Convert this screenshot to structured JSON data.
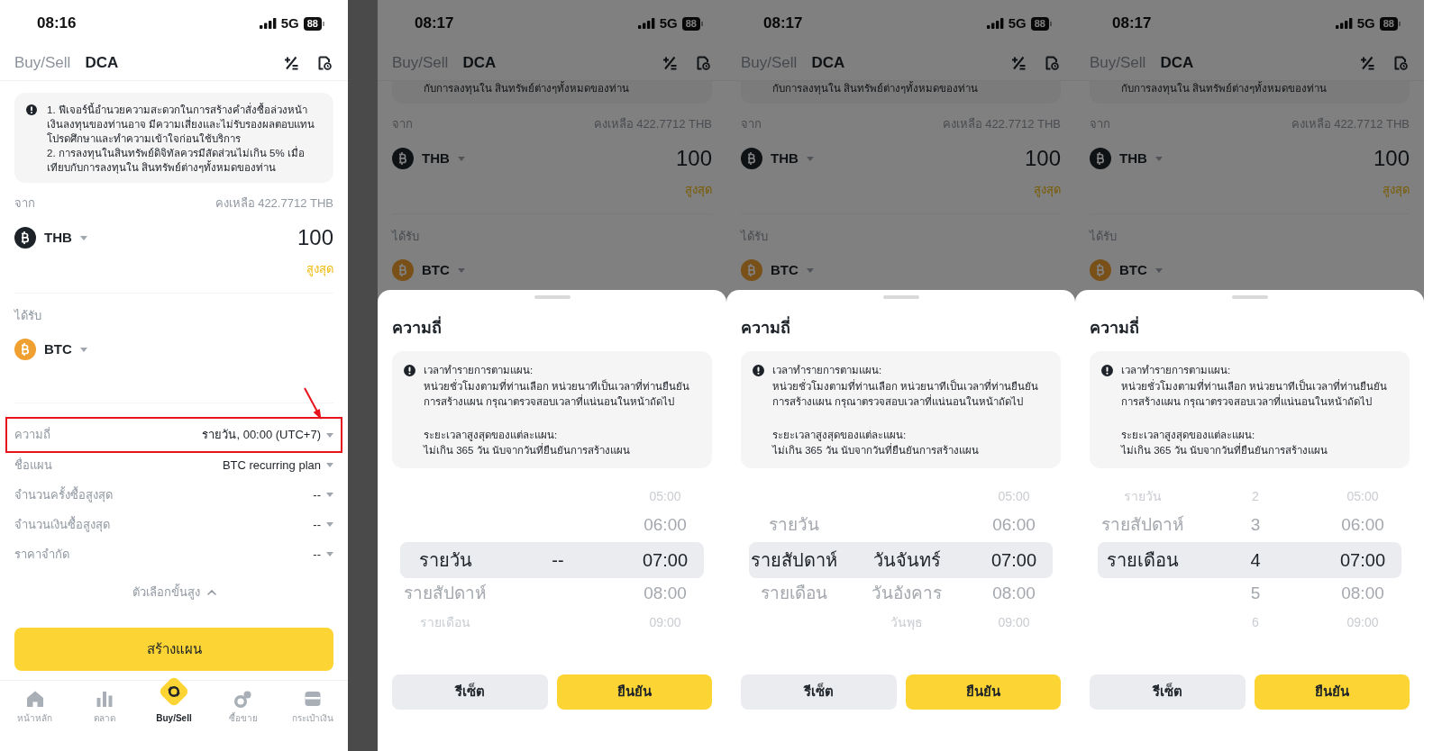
{
  "screens": [
    {
      "status_bar": {
        "time": "08:16",
        "network": "5G",
        "battery": "88"
      },
      "tabs": [
        {
          "label": "Buy/Sell",
          "selected": false
        },
        {
          "label": "DCA",
          "selected": true
        }
      ],
      "notice": {
        "clipped": false,
        "paragraphs": [
          "1. ฟีเจอร์นี้อำนวยความสะดวกในการสร้างคำสั่งซื้อล่วงหน้า เงินลงทุนของท่านอาจ มีความเสี่ยงและไม่รับรองผลตอบแทน โปรดศึกษาและทำความเข้าใจก่อนใช้บริการ",
          "2. การลงทุนในสินทรัพย์ดิจิทัลควรมีสัดส่วนไม่เกิน 5% เมื่อเทียบกับการลงทุนใน สินทรัพย์ต่างๆทั้งหมดของท่าน"
        ]
      },
      "from": {
        "label": "จาก",
        "balance": "คงเหลือ 422.7712 THB",
        "currency": "THB",
        "amount": "100",
        "max_label": "สูงสุด"
      },
      "to": {
        "label": "ได้รับ",
        "currency": "BTC"
      },
      "settings": [
        {
          "label": "ความถี่",
          "value": "รายวัน, 00:00 (UTC+7)",
          "highlighted": true
        },
        {
          "label": "ชื่อแผน",
          "value": "BTC recurring plan",
          "highlighted": false
        },
        {
          "label": "จำนวนครั้งซื้อสูงสุด",
          "value": "--",
          "highlighted": false
        },
        {
          "label": "จำนวนเงินซื้อสูงสุด",
          "value": "--",
          "highlighted": false
        },
        {
          "label": "ราคาจำกัด",
          "value": "--",
          "highlighted": false
        }
      ],
      "advanced_options": {
        "label": "ตัวเลือกขั้นสูง",
        "expanded": true
      },
      "create_button": "สร้างแผน",
      "bottom_nav": [
        {
          "label": "หน้าหลัก",
          "selected": false
        },
        {
          "label": "ตลาด",
          "selected": false
        },
        {
          "label": "Buy/Sell",
          "selected": true
        },
        {
          "label": "ซื้อขาย",
          "selected": false
        },
        {
          "label": "กระเป๋าเงิน",
          "selected": false
        }
      ]
    },
    {
      "status_bar": {
        "time": "08:17",
        "network": "5G",
        "battery": "88"
      },
      "tabs": [
        {
          "label": "Buy/Sell",
          "selected": false
        },
        {
          "label": "DCA",
          "selected": true
        }
      ],
      "notice": {
        "clipped": true,
        "paragraphs": [
          "กับการลงทุนใน สินทรัพย์ต่างๆทั้งหมดของท่าน"
        ]
      },
      "from": {
        "label": "จาก",
        "balance": "คงเหลือ 422.7712 THB",
        "currency": "THB",
        "amount": "100",
        "max_label": "สูงสุด"
      },
      "to": {
        "label": "ได้รับ",
        "currency": "BTC"
      },
      "sheet": {
        "title": "ความถี่",
        "info": [
          {
            "heading": "เวลาทำรายการตามแผน:",
            "text": "หน่วยชั่วโมงตามที่ท่านเลือก หน่วยนาทีเป็นเวลาที่ท่านยืนยันการสร้างแผน กรุณาตรวจสอบเวลาที่แน่นอนในหน้าถัดไป"
          },
          {
            "heading": "ระยะเวลาสูงสุดของแต่ละแผน:",
            "text": "ไม่เกิน 365 วัน นับจากวันที่ยืนยันการสร้างแผน"
          }
        ],
        "picker": {
          "columns": [
            {
              "items": [
                {
                  "text": "รายวัน",
                  "selected": true
                },
                {
                  "text": "รายสัปดาห์",
                  "selected": false
                },
                {
                  "text": "รายเดือน",
                  "selected": false
                }
              ]
            },
            {
              "items": [
                {
                  "text": "--",
                  "selected": true
                }
              ]
            },
            {
              "items": [
                {
                  "text": "05:00",
                  "selected": false
                },
                {
                  "text": "06:00",
                  "selected": false
                },
                {
                  "text": "07:00",
                  "selected": true
                },
                {
                  "text": "08:00",
                  "selected": false
                },
                {
                  "text": "09:00",
                  "selected": false
                }
              ]
            }
          ]
        },
        "buttons": [
          {
            "label": "รีเซ็ต",
            "kind": "secondary"
          },
          {
            "label": "ยืนยัน",
            "kind": "primary"
          }
        ]
      }
    },
    {
      "status_bar": {
        "time": "08:17",
        "network": "5G",
        "battery": "88"
      },
      "tabs": [
        {
          "label": "Buy/Sell",
          "selected": false
        },
        {
          "label": "DCA",
          "selected": true
        }
      ],
      "notice": {
        "clipped": true,
        "paragraphs": [
          "กับการลงทุนใน สินทรัพย์ต่างๆทั้งหมดของท่าน"
        ]
      },
      "from": {
        "label": "จาก",
        "balance": "คงเหลือ 422.7712 THB",
        "currency": "THB",
        "amount": "100",
        "max_label": "สูงสุด"
      },
      "to": {
        "label": "ได้รับ",
        "currency": "BTC"
      },
      "sheet": {
        "title": "ความถี่",
        "info": [
          {
            "heading": "เวลาทำรายการตามแผน:",
            "text": "หน่วยชั่วโมงตามที่ท่านเลือก หน่วยนาทีเป็นเวลาที่ท่านยืนยันการสร้างแผน กรุณาตรวจสอบเวลาที่แน่นอนในหน้าถัดไป"
          },
          {
            "heading": "ระยะเวลาสูงสุดของแต่ละแผน:",
            "text": "ไม่เกิน 365 วัน นับจากวันที่ยืนยันการสร้างแผน"
          }
        ],
        "picker": {
          "columns": [
            {
              "items": [
                {
                  "text": "รายวัน",
                  "selected": false
                },
                {
                  "text": "รายสัปดาห์",
                  "selected": true
                },
                {
                  "text": "รายเดือน",
                  "selected": false
                }
              ]
            },
            {
              "items": [
                {
                  "text": "วันจันทร์",
                  "selected": true
                },
                {
                  "text": "วันอังคาร",
                  "selected": false
                },
                {
                  "text": "วันพุธ",
                  "selected": false
                }
              ]
            },
            {
              "items": [
                {
                  "text": "05:00",
                  "selected": false
                },
                {
                  "text": "06:00",
                  "selected": false
                },
                {
                  "text": "07:00",
                  "selected": true
                },
                {
                  "text": "08:00",
                  "selected": false
                },
                {
                  "text": "09:00",
                  "selected": false
                }
              ]
            }
          ]
        },
        "buttons": [
          {
            "label": "รีเซ็ต",
            "kind": "secondary"
          },
          {
            "label": "ยืนยัน",
            "kind": "primary"
          }
        ]
      }
    },
    {
      "status_bar": {
        "time": "08:17",
        "network": "5G",
        "battery": "88"
      },
      "tabs": [
        {
          "label": "Buy/Sell",
          "selected": false
        },
        {
          "label": "DCA",
          "selected": true
        }
      ],
      "notice": {
        "clipped": true,
        "paragraphs": [
          "กับการลงทุนใน สินทรัพย์ต่างๆทั้งหมดของท่าน"
        ]
      },
      "from": {
        "label": "จาก",
        "balance": "คงเหลือ 422.7712 THB",
        "currency": "THB",
        "amount": "100",
        "max_label": "สูงสุด"
      },
      "to": {
        "label": "ได้รับ",
        "currency": "BTC"
      },
      "sheet": {
        "title": "ความถี่",
        "info": [
          {
            "heading": "เวลาทำรายการตามแผน:",
            "text": "หน่วยชั่วโมงตามที่ท่านเลือก หน่วยนาทีเป็นเวลาที่ท่านยืนยันการสร้างแผน กรุณาตรวจสอบเวลาที่แน่นอนในหน้าถัดไป"
          },
          {
            "heading": "ระยะเวลาสูงสุดของแต่ละแผน:",
            "text": "ไม่เกิน 365 วัน นับจากวันที่ยืนยันการสร้างแผน"
          }
        ],
        "picker": {
          "columns": [
            {
              "items": [
                {
                  "text": "รายวัน",
                  "selected": false
                },
                {
                  "text": "รายสัปดาห์",
                  "selected": false
                },
                {
                  "text": "รายเดือน",
                  "selected": true
                }
              ]
            },
            {
              "items": [
                {
                  "text": "2",
                  "selected": false
                },
                {
                  "text": "3",
                  "selected": false
                },
                {
                  "text": "4",
                  "selected": true
                },
                {
                  "text": "5",
                  "selected": false
                },
                {
                  "text": "6",
                  "selected": false
                }
              ]
            },
            {
              "items": [
                {
                  "text": "05:00",
                  "selected": false
                },
                {
                  "text": "06:00",
                  "selected": false
                },
                {
                  "text": "07:00",
                  "selected": true
                },
                {
                  "text": "08:00",
                  "selected": false
                },
                {
                  "text": "09:00",
                  "selected": false
                }
              ]
            }
          ]
        },
        "buttons": [
          {
            "label": "รีเซ็ต",
            "kind": "secondary"
          },
          {
            "label": "ยืนยัน",
            "kind": "primary"
          }
        ]
      }
    }
  ]
}
